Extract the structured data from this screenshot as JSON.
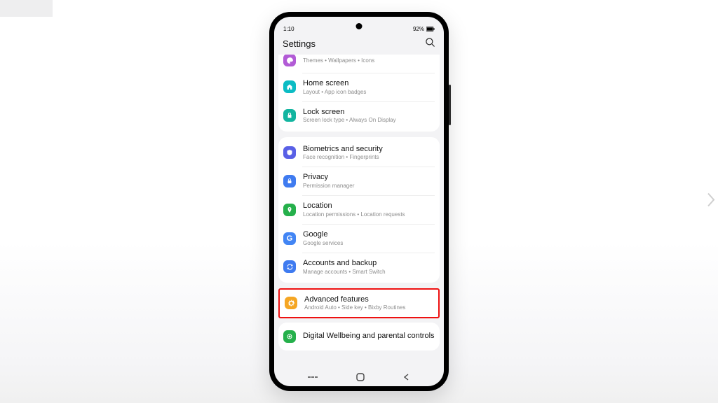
{
  "status": {
    "time": "1:10",
    "battery": "92%"
  },
  "header": {
    "title": "Settings"
  },
  "rows": {
    "themes": {
      "subtitle": "Themes  •  Wallpapers  •  Icons"
    },
    "home": {
      "title": "Home screen",
      "subtitle": "Layout  •  App icon badges"
    },
    "lock": {
      "title": "Lock screen",
      "subtitle": "Screen lock type  •  Always On Display"
    },
    "bio": {
      "title": "Biometrics and security",
      "subtitle": "Face recognition  •  Fingerprints"
    },
    "privacy": {
      "title": "Privacy",
      "subtitle": "Permission manager"
    },
    "location": {
      "title": "Location",
      "subtitle": "Location permissions  •  Location requests"
    },
    "google": {
      "title": "Google",
      "subtitle": "Google services"
    },
    "accounts": {
      "title": "Accounts and backup",
      "subtitle": "Manage accounts  •  Smart Switch"
    },
    "advanced": {
      "title": "Advanced features",
      "subtitle": "Android Auto  •  Side key  •  Bixby Routines"
    },
    "wellbeing": {
      "title": "Digital Wellbeing and parental controls"
    }
  },
  "colors": {
    "themes": "#b25bd6",
    "home": "#0bbcc4",
    "lock": "#12b5a0",
    "bio": "#5960e6",
    "privacy": "#3f7bf0",
    "location": "#25b04b",
    "google": "#4285f4",
    "accounts": "#3f7bf0",
    "advanced": "#f5a623",
    "wellbeing": "#25b04b"
  }
}
